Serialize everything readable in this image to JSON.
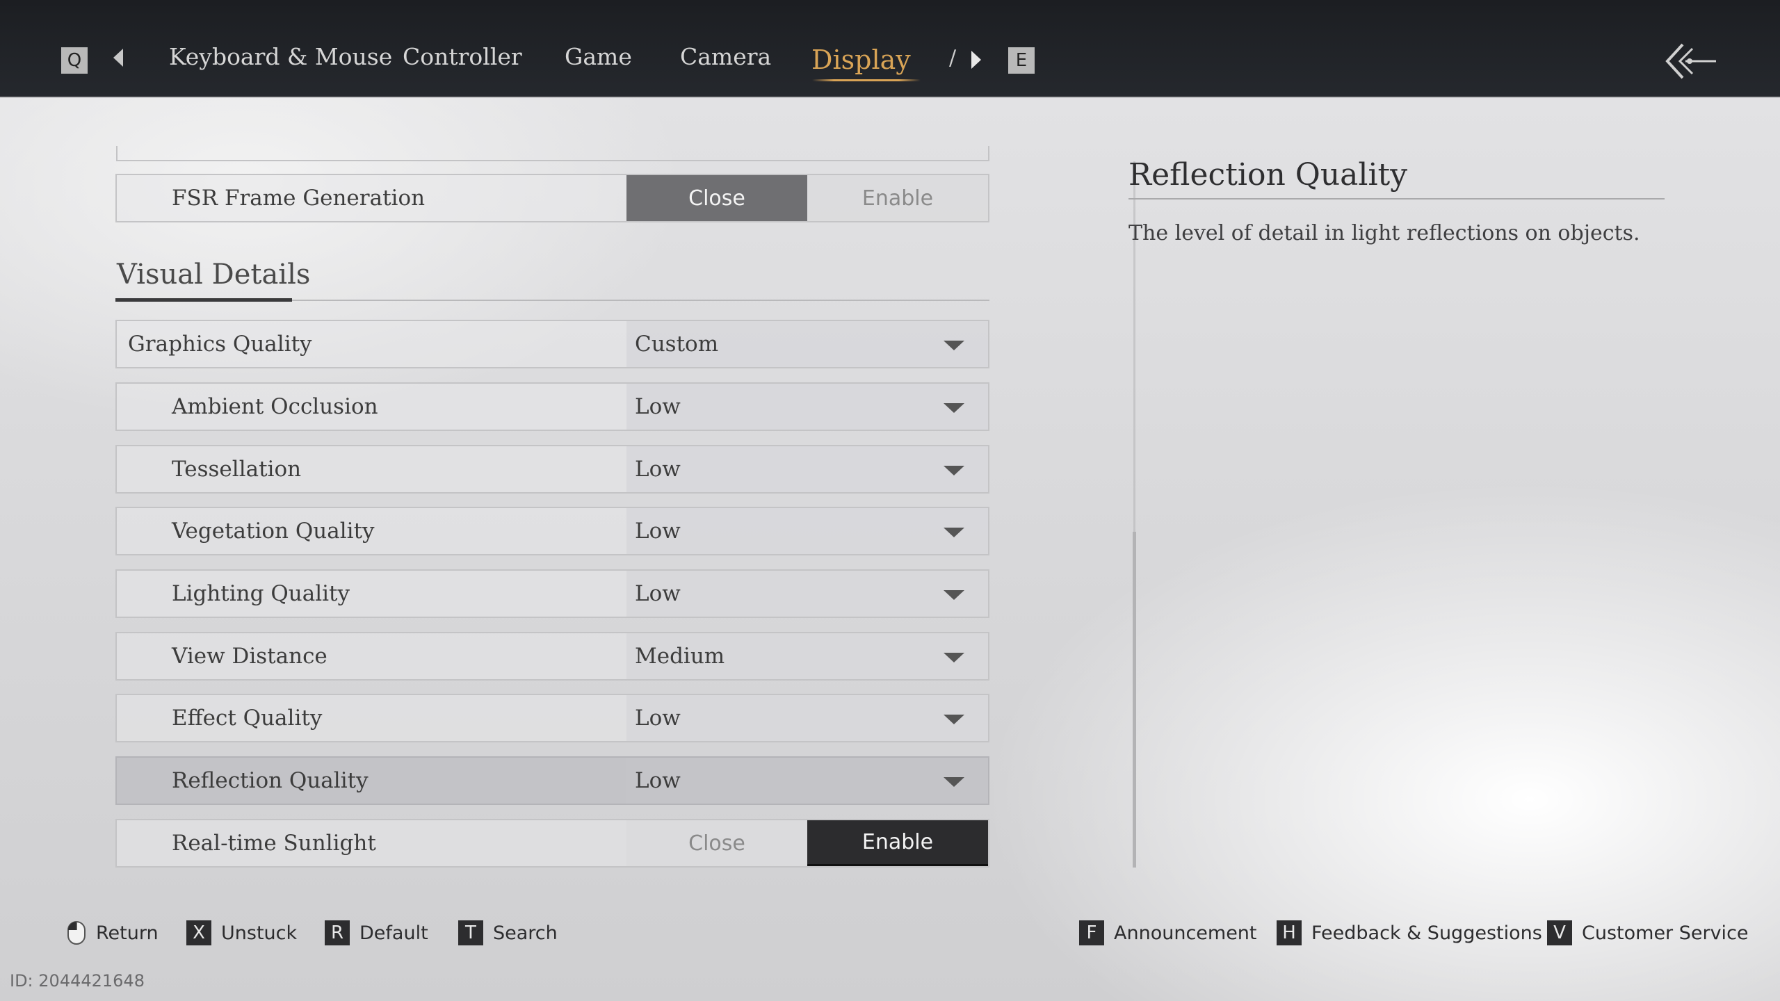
{
  "nav": {
    "prev_key": "Q",
    "next_key": "E",
    "tabs": [
      {
        "label": "Keyboard & Mouse",
        "active": false
      },
      {
        "label": "Controller",
        "active": false
      },
      {
        "label": "Game",
        "active": false
      },
      {
        "label": "Camera",
        "active": false
      },
      {
        "label": "Display",
        "active": true
      }
    ],
    "cut_tab": "/",
    "accent_color": "#d9a456"
  },
  "settings": {
    "fsr_frame_generation": {
      "label": "FSR Frame Generation",
      "options": [
        "Close",
        "Enable"
      ],
      "selected": "Close"
    },
    "section_title": "Visual Details",
    "graphics_quality": {
      "label": "Graphics Quality",
      "value": "Custom"
    },
    "rows": [
      {
        "label": "Ambient Occlusion",
        "value": "Low"
      },
      {
        "label": "Tessellation",
        "value": "Low"
      },
      {
        "label": "Vegetation Quality",
        "value": "Low"
      },
      {
        "label": "Lighting Quality",
        "value": "Low"
      },
      {
        "label": "View Distance",
        "value": "Medium"
      },
      {
        "label": "Effect Quality",
        "value": "Low"
      },
      {
        "label": "Reflection Quality",
        "value": "Low",
        "selected": true
      }
    ],
    "realtime_sunlight": {
      "label": "Real-time Sunlight",
      "options": [
        "Close",
        "Enable"
      ],
      "selected": "Enable"
    }
  },
  "description": {
    "title": "Reflection Quality",
    "text": "The level of detail in light reflections on objects."
  },
  "footer": {
    "left": [
      {
        "key": "mouse-icon",
        "label": "Return"
      },
      {
        "key": "X",
        "label": "Unstuck"
      },
      {
        "key": "R",
        "label": "Default"
      },
      {
        "key": "T",
        "label": "Search"
      }
    ],
    "right": [
      {
        "key": "F",
        "label": "Announcement"
      },
      {
        "key": "H",
        "label": "Feedback & Suggestions"
      },
      {
        "key": "V",
        "label": "Customer Service"
      }
    ]
  },
  "id_text": "ID: 2044421648"
}
